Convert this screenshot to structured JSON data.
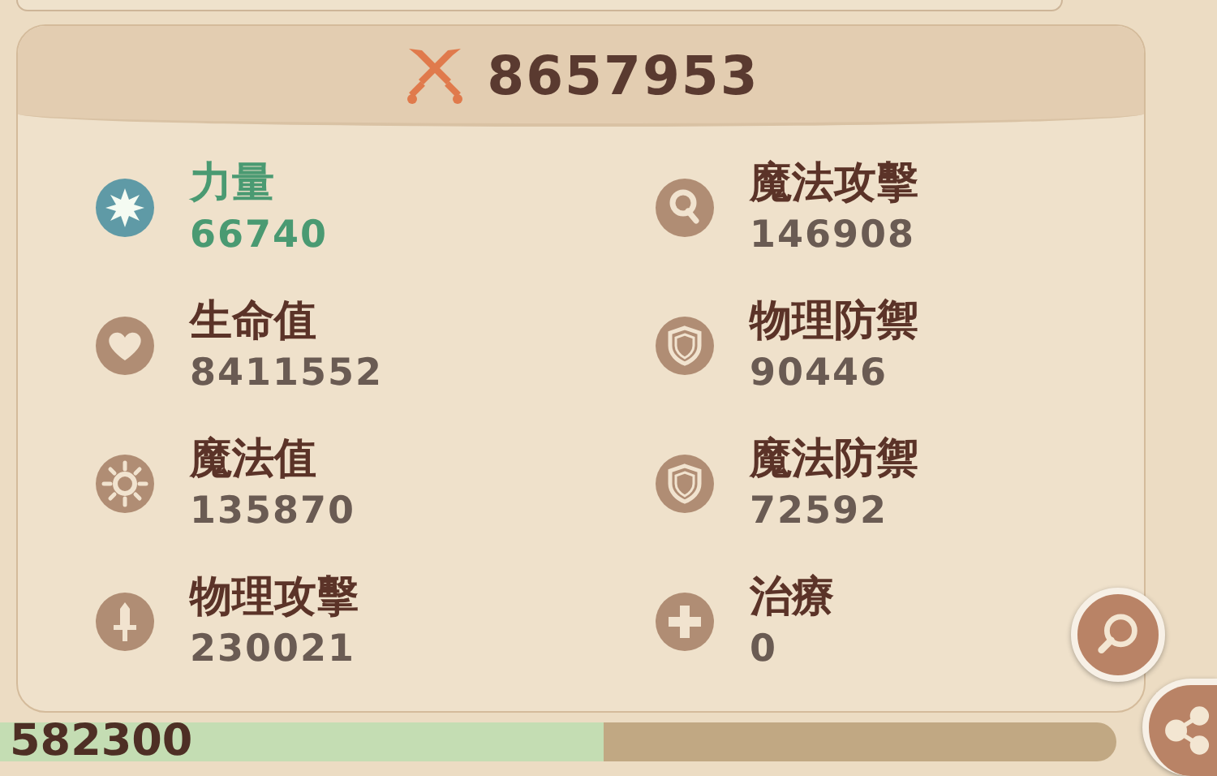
{
  "power": {
    "value": "8657953"
  },
  "stats": [
    {
      "label": "力量",
      "value": "66740",
      "highlighted": true
    },
    {
      "label": "魔法攻擊",
      "value": "146908",
      "highlighted": false
    },
    {
      "label": "生命值",
      "value": "8411552",
      "highlighted": false
    },
    {
      "label": "物理防禦",
      "value": "90446",
      "highlighted": false
    },
    {
      "label": "魔法值",
      "value": "135870",
      "highlighted": false
    },
    {
      "label": "魔法防禦",
      "value": "72592",
      "highlighted": false
    },
    {
      "label": "物理攻擊",
      "value": "230021",
      "highlighted": false
    },
    {
      "label": "治療",
      "value": "0",
      "highlighted": false
    }
  ],
  "progress": {
    "reading": "582300",
    "level": 0.54
  }
}
